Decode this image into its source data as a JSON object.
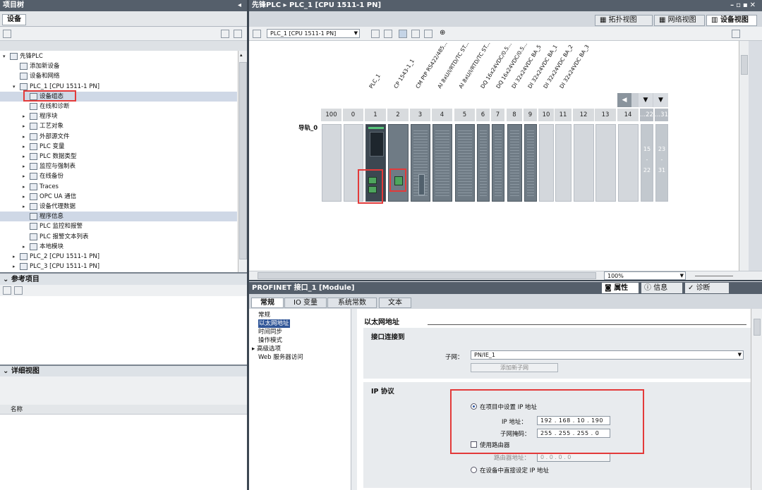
{
  "project_tree": {
    "title": "项目树",
    "tab": "设备",
    "items": [
      {
        "label": "先锋PLC",
        "level": 0,
        "arrow": "▾"
      },
      {
        "label": "添加新设备",
        "level": 1,
        "arrow": ""
      },
      {
        "label": "设备和网络",
        "level": 1,
        "arrow": ""
      },
      {
        "label": "PLC_1 [CPU 1511-1 PN]",
        "level": 1,
        "arrow": "▾"
      },
      {
        "label": "设备组态",
        "level": 2,
        "arrow": ""
      },
      {
        "label": "在线和诊断",
        "level": 2,
        "arrow": ""
      },
      {
        "label": "程序块",
        "level": 2,
        "arrow": "▸"
      },
      {
        "label": "工艺对象",
        "level": 2,
        "arrow": "▸"
      },
      {
        "label": "外部源文件",
        "level": 2,
        "arrow": "▸"
      },
      {
        "label": "PLC 变量",
        "level": 2,
        "arrow": "▸"
      },
      {
        "label": "PLC 数据类型",
        "level": 2,
        "arrow": "▸"
      },
      {
        "label": "监控与强制表",
        "level": 2,
        "arrow": "▸"
      },
      {
        "label": "在线备份",
        "level": 2,
        "arrow": "▸"
      },
      {
        "label": "Traces",
        "level": 2,
        "arrow": "▸"
      },
      {
        "label": "OPC UA 通信",
        "level": 2,
        "arrow": "▸"
      },
      {
        "label": "设备代理数据",
        "level": 2,
        "arrow": "▸"
      },
      {
        "label": "程序信息",
        "level": 2,
        "arrow": ""
      },
      {
        "label": "PLC 监控和报警",
        "level": 2,
        "arrow": ""
      },
      {
        "label": "PLC 报警文本列表",
        "level": 2,
        "arrow": ""
      },
      {
        "label": "本地模块",
        "level": 2,
        "arrow": "▸"
      },
      {
        "label": "PLC_2 [CPU 1511-1 PN]",
        "level": 1,
        "arrow": "▸"
      },
      {
        "label": "PLC_3 [CPU 1511-1 PN]",
        "level": 1,
        "arrow": "▸"
      }
    ]
  },
  "reference": {
    "title": "参考项目"
  },
  "details": {
    "title": "详细视图",
    "col_name": "名称"
  },
  "editor": {
    "breadcrumb": "先锋PLC ▸ PLC_1 [CPU 1511-1 PN]",
    "view_tabs": [
      "拓扑视图",
      "网络视图",
      "设备视图"
    ],
    "device_select": "PLC_1 [CPU 1511-1 PN]",
    "rail_label": "导轨_0",
    "columns": [
      "PLC_1",
      "CP 1543-1_1",
      "CM PtP RS422/485...",
      "AI 8xU/I/RTD/TC ST...",
      "AI 8xU/I/RTD/TC ST...",
      "DQ 16x24VDC/0.5...",
      "DQ 16x24VDC/0.5...",
      "DI 32x24VDC BA_5",
      "DI 32x24VDC BA_1",
      "DI 32x24VDC BA_2",
      "DI 32x24VDC BA_3"
    ],
    "slots": [
      "100",
      "0",
      "1",
      "2",
      "3",
      "4",
      "5",
      "6",
      "7",
      "8",
      "9",
      "10",
      "11",
      "12",
      "13",
      "14",
      "...22",
      "...31"
    ],
    "slot22": [
      "15",
      "-",
      "22"
    ],
    "slot31": [
      "23",
      "-",
      "31"
    ],
    "zoom": "100%"
  },
  "module": {
    "title": "PROFINET 接口_1 [Module]",
    "inspector_tabs": [
      "属性",
      "信息",
      "诊断"
    ],
    "tabs": [
      "常规",
      "IO 变量",
      "系统常数",
      "文本"
    ],
    "nav": [
      "常规",
      "以太网地址",
      "时间同步",
      "操作模式",
      "高级选项",
      "Web 服务器访问"
    ],
    "section": "以太网地址",
    "connect_title": "接口连接到",
    "subnet_label": "子网：",
    "subnet_value": "PN/IE_1",
    "add_subnet": "添加新子网",
    "ip_title": "IP 协议",
    "opt_project": "在项目中设置 IP 地址",
    "ip_label": "IP 地址：",
    "ip": [
      "192",
      "168",
      "10",
      "190"
    ],
    "mask_label": "子网掩码：",
    "mask": [
      "255",
      "255",
      "255",
      "0"
    ],
    "router_use": "使用路由器",
    "router_label": "路由器地址：",
    "router": [
      "0",
      "0",
      "0",
      "0"
    ],
    "opt_device": "在设备中直接设定 IP 地址"
  }
}
